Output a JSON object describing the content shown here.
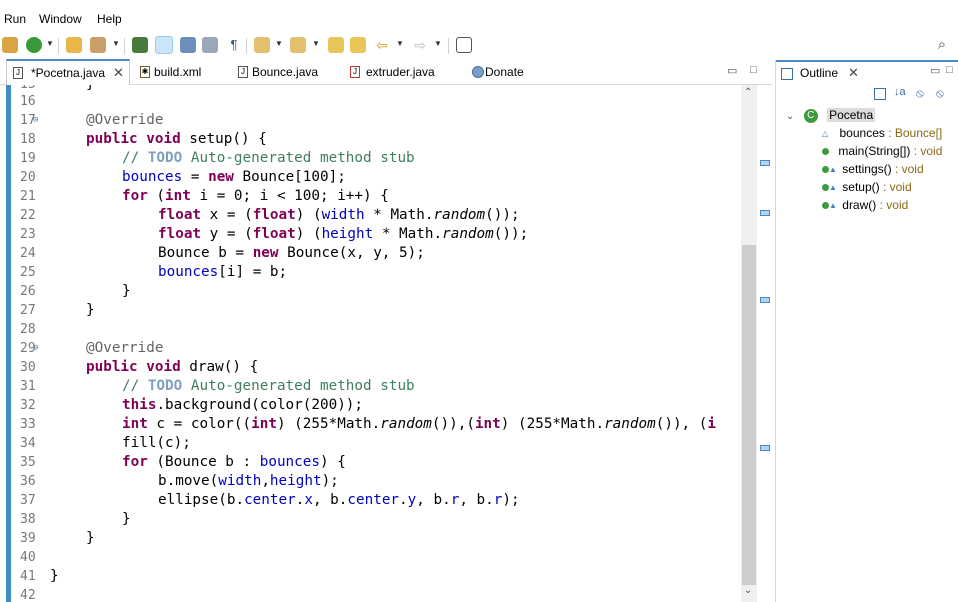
{
  "menu": {
    "items": [
      "Run",
      "Window",
      "Help"
    ]
  },
  "tabs": [
    {
      "label": "*Pocetna.java",
      "active": true,
      "closable": true
    },
    {
      "label": "build.xml",
      "active": false
    },
    {
      "label": "Bounce.java",
      "active": false
    },
    {
      "label": "extruder.java",
      "active": false
    },
    {
      "label": "Donate",
      "active": false
    }
  ],
  "outline": {
    "title": "Outline",
    "root": "Pocetna",
    "members": [
      {
        "name": "bounces",
        "type": " : Bounce[]"
      },
      {
        "name": "main(String[])",
        "type": " : void"
      },
      {
        "name": "settings()",
        "type": " : void"
      },
      {
        "name": "setup()",
        "type": " : void"
      },
      {
        "name": "draw()",
        "type": " : void"
      }
    ]
  },
  "editor": {
    "lines": [
      {
        "n": "15",
        "t": "}"
      },
      {
        "n": "16",
        "t": ""
      },
      {
        "n": "17",
        "t": "@Override"
      },
      {
        "n": "18",
        "t": "public void setup() {"
      },
      {
        "n": "19",
        "t": "// TODO Auto-generated method stub"
      },
      {
        "n": "20",
        "t": "bounces = new Bounce[100];"
      },
      {
        "n": "21",
        "t": "for (int i = 0; i < 100; i++) {"
      },
      {
        "n": "22",
        "t": "float x = (float) (width * Math.random());"
      },
      {
        "n": "23",
        "t": "float y = (float) (height * Math.random());"
      },
      {
        "n": "24",
        "t": "Bounce b = new Bounce(x, y, 5);"
      },
      {
        "n": "25",
        "t": "bounces[i] = b;"
      },
      {
        "n": "26",
        "t": "}"
      },
      {
        "n": "27",
        "t": "}"
      },
      {
        "n": "28",
        "t": ""
      },
      {
        "n": "29",
        "t": "@Override"
      },
      {
        "n": "30",
        "t": "public void draw() {"
      },
      {
        "n": "31",
        "t": "// TODO Auto-generated method stub"
      },
      {
        "n": "32",
        "t": "this.background(color(200));"
      },
      {
        "n": "33",
        "t": "int c = color((int) (255*Math.random()),(int) (255*Math.random()), (i"
      },
      {
        "n": "34",
        "t": "fill(c);"
      },
      {
        "n": "35",
        "t": "for (Bounce b : bounces) {"
      },
      {
        "n": "36",
        "t": "b.move(width,height);"
      },
      {
        "n": "37",
        "t": "ellipse(b.center.x, b.center.y, b.r, b.r);"
      },
      {
        "n": "38",
        "t": "}"
      },
      {
        "n": "39",
        "t": "}"
      },
      {
        "n": "40",
        "t": ""
      },
      {
        "n": "41",
        "t": "}"
      },
      {
        "n": "42",
        "t": ""
      }
    ]
  }
}
